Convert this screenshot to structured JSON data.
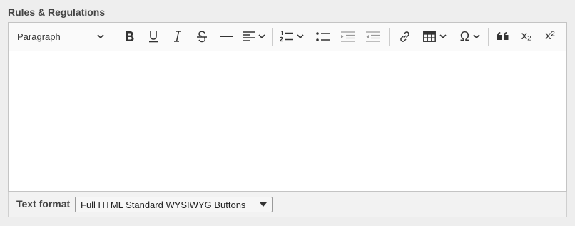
{
  "field": {
    "label": "Rules & Regulations"
  },
  "toolbar": {
    "heading_value": "Paragraph",
    "icons": {
      "omega": "Ω",
      "subscript": "x₂",
      "superscript": "x²"
    }
  },
  "editor": {
    "content": ""
  },
  "text_format": {
    "label": "Text format",
    "selected": "Full HTML Standard WYSIWYG Buttons"
  }
}
